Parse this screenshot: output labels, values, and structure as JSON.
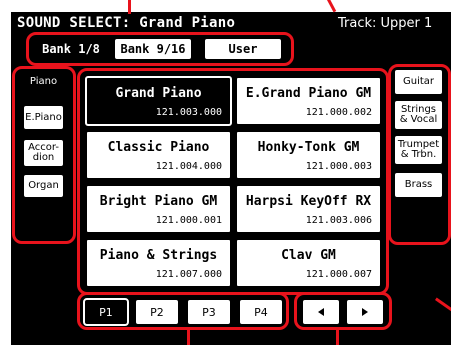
{
  "header": {
    "title": "SOUND SELECT: Grand Piano",
    "track": "Track: Upper 1"
  },
  "banks": [
    {
      "label": "Bank 1/8",
      "selected": true
    },
    {
      "label": "Bank 9/16",
      "selected": false
    },
    {
      "label": "User",
      "selected": false
    }
  ],
  "left_tabs": [
    {
      "label": "Piano",
      "selected": true
    },
    {
      "label": "E.Piano",
      "selected": false
    },
    {
      "label": "Accor-\ndion",
      "selected": false
    },
    {
      "label": "Organ",
      "selected": false
    }
  ],
  "right_tabs": [
    {
      "label": "Guitar"
    },
    {
      "label": "Strings\n& Vocal"
    },
    {
      "label": "Trumpet\n& Trbn."
    },
    {
      "label": "Brass"
    }
  ],
  "sounds": [
    {
      "name": "Grand Piano",
      "code": "121.003.000",
      "selected": true
    },
    {
      "name": "E.Grand Piano GM",
      "code": "121.000.002",
      "selected": false
    },
    {
      "name": "Classic Piano",
      "code": "121.004.000",
      "selected": false
    },
    {
      "name": "Honky-Tonk GM",
      "code": "121.000.003",
      "selected": false
    },
    {
      "name": "Bright Piano GM",
      "code": "121.000.001",
      "selected": false
    },
    {
      "name": "Harpsi KeyOff RX",
      "code": "121.003.006",
      "selected": false
    },
    {
      "name": "Piano & Strings",
      "code": "121.007.000",
      "selected": false
    },
    {
      "name": "Clav GM",
      "code": "121.000.007",
      "selected": false
    }
  ],
  "pages": [
    {
      "label": "P1",
      "selected": true
    },
    {
      "label": "P2",
      "selected": false
    },
    {
      "label": "P3",
      "selected": false
    },
    {
      "label": "P4",
      "selected": false
    }
  ],
  "icons": {
    "prev": "triangle-left-icon",
    "next": "triangle-right-icon"
  },
  "colors": {
    "annotation": "#e8131c",
    "display": "#000000",
    "button": "#ffffff"
  }
}
